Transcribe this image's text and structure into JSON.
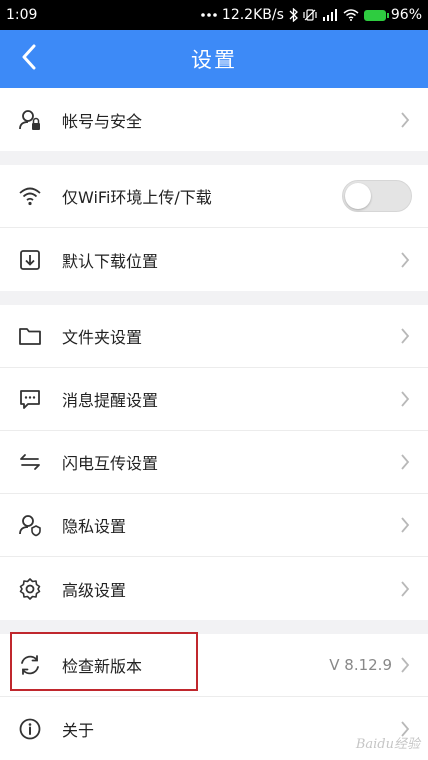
{
  "status_bar": {
    "time": "1:09",
    "network_speed": "12.2KB/s",
    "battery": "96%",
    "icons": [
      "more-dots-icon",
      "bluetooth-icon",
      "vibrate-icon",
      "signal-icon",
      "wifi-icon",
      "battery-icon"
    ]
  },
  "header": {
    "title": "设置",
    "back_icon": "chevron-left-icon"
  },
  "groups": [
    {
      "items": [
        {
          "label": "帐号与安全",
          "icon": "user-lock-icon",
          "control": "chevron"
        }
      ]
    },
    {
      "items": [
        {
          "label": "仅WiFi环境上传/下载",
          "icon": "wifi-icon",
          "control": "toggle",
          "toggle_on": false
        },
        {
          "label": "默认下载位置",
          "icon": "download-box-icon",
          "control": "chevron"
        }
      ]
    },
    {
      "items": [
        {
          "label": "文件夹设置",
          "icon": "folder-icon",
          "control": "chevron"
        },
        {
          "label": "消息提醒设置",
          "icon": "message-icon",
          "control": "chevron"
        },
        {
          "label": "闪电互传设置",
          "icon": "transfer-arrows-icon",
          "control": "chevron"
        },
        {
          "label": "隐私设置",
          "icon": "user-shield-icon",
          "control": "chevron"
        },
        {
          "label": "高级设置",
          "icon": "gear-icon",
          "control": "chevron"
        }
      ]
    },
    {
      "items": [
        {
          "label": "检查新版本",
          "icon": "refresh-icon",
          "control": "chevron",
          "value": "V 8.12.9"
        },
        {
          "label": "关于",
          "icon": "info-icon",
          "control": "chevron"
        }
      ]
    }
  ],
  "watermark": "Baidu经验",
  "colors": {
    "header_bg": "#3d8af7",
    "highlight_border": "#c0272d",
    "page_bg": "#f2f2f4"
  }
}
